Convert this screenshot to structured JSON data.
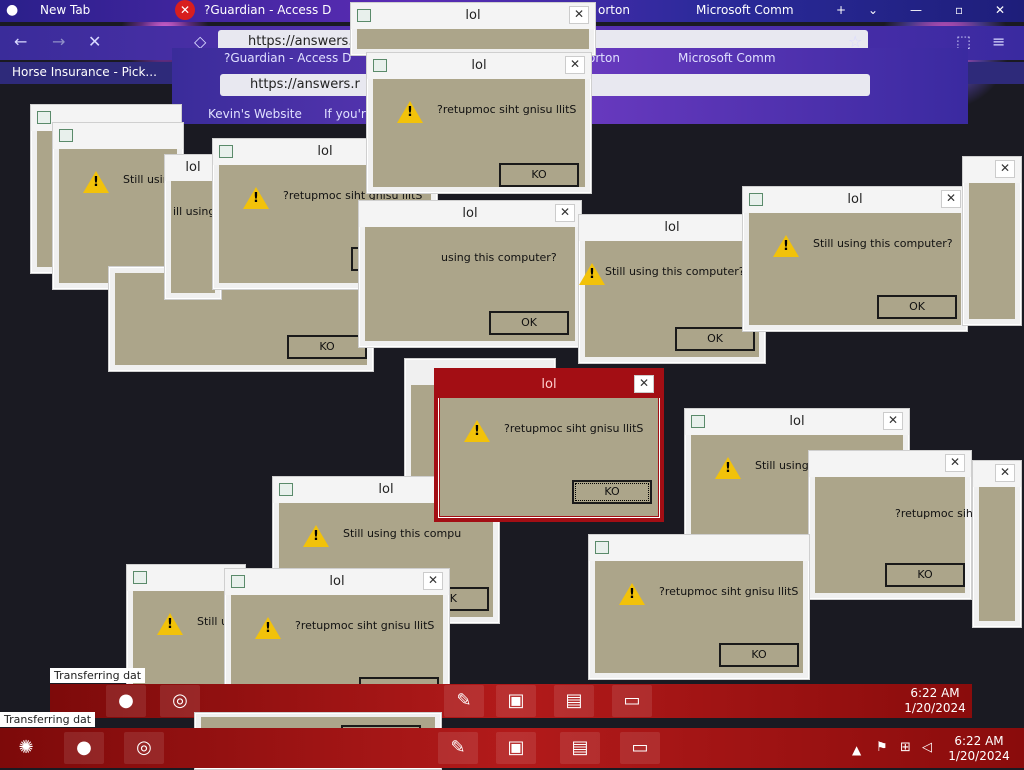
{
  "browser": {
    "tabs": [
      "New Tab",
      "?Guardian - Access D",
      "lol",
      "orton",
      "Microsoft Comm"
    ],
    "url": "https://answers.r",
    "url_echo": "https://answers.r",
    "bookmarks": [
      "Horse Insurance - Pick...",
      "Kevin's Website",
      "If you're"
    ],
    "echo_tabs": [
      "?Guardian - Access D",
      "orton",
      "Microsoft Comm"
    ]
  },
  "dialog_title": "lol",
  "msg_forward": "Still using this computer?",
  "msg_reversed": "?retupmoc siht gnisu llitS",
  "msg_partial_using": "using this computer?",
  "msg_partial_comp": "comp",
  "msg_still_using": "Still using",
  "msg_still_u": "Still u",
  "msg_ill_using": "ill using",
  "msg_still_using_compu": "Still using this compu",
  "msg_reversed_cut": "?retupmoc siht gnisu",
  "ok_label": "OK",
  "ok_reversed": "KO",
  "ok_mirror": "OK",
  "taskbar": {
    "time": "6:22 AM",
    "date": "1/20/2024",
    "transfer_text": "Transferring dat"
  },
  "colors": {
    "dialog_body": "#aca58a",
    "alert_red": "#a30e14",
    "taskbar_red": "#b21a1a"
  }
}
